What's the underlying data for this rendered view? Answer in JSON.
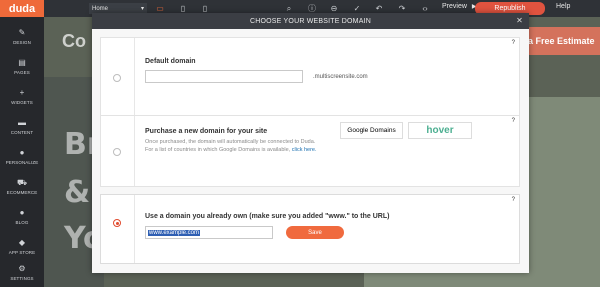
{
  "topbar": {
    "logo": "duda",
    "page_select": "Home",
    "preview": "Preview",
    "republish": "Republish",
    "help": "Help",
    "icons": [
      "desktop-icon",
      "tablet-icon",
      "mobile-icon",
      "search-icon",
      "info-icon",
      "minus-icon",
      "check-icon",
      "undo-icon",
      "redo-icon",
      "code-icon",
      "play-icon"
    ]
  },
  "sidebar": {
    "items": [
      {
        "label": "DESIGN",
        "icon": "brush-icon"
      },
      {
        "label": "PAGES",
        "icon": "pages-icon"
      },
      {
        "label": "WIDGETS",
        "icon": "plus-icon"
      },
      {
        "label": "CONTENT",
        "icon": "folder-icon"
      },
      {
        "label": "PERSONALIZE",
        "icon": "person-icon"
      },
      {
        "label": "ECOMMERCE",
        "icon": "cart-icon"
      },
      {
        "label": "BLOG",
        "icon": "chat-icon"
      },
      {
        "label": "APP STORE",
        "icon": "appstore-icon"
      },
      {
        "label": "SETTINGS",
        "icon": "gear-icon"
      }
    ]
  },
  "canvas": {
    "cta_label": "a Free Estimate",
    "cu_text": "Co",
    "hero_lines": [
      "Br",
      "&",
      "Yo"
    ]
  },
  "modal": {
    "title": "CHOOSE YOUR WEBSITE DOMAIN",
    "close": "✕",
    "help": "?",
    "default": {
      "title": "Default domain",
      "input_value": "",
      "suffix": ".multiscreensite.com"
    },
    "purchase": {
      "title": "Purchase a new domain for your site",
      "desc_line1": "Once purchased, the domain will automatically be connected to Duda.",
      "desc_line2_prefix": "For a list of countries in which Google Domains is available,",
      "desc_link": "click here.",
      "provider_google": "Google Domains",
      "provider_hover": "hover"
    },
    "own": {
      "title": "Use a domain you already own (make sure you added \"www.\" to the URL)",
      "input_value": "www.example.com",
      "save": "Save"
    }
  },
  "colors": {
    "accent": "#ef6a3a",
    "republish": "#e0533f",
    "link": "#1a6fb0"
  }
}
